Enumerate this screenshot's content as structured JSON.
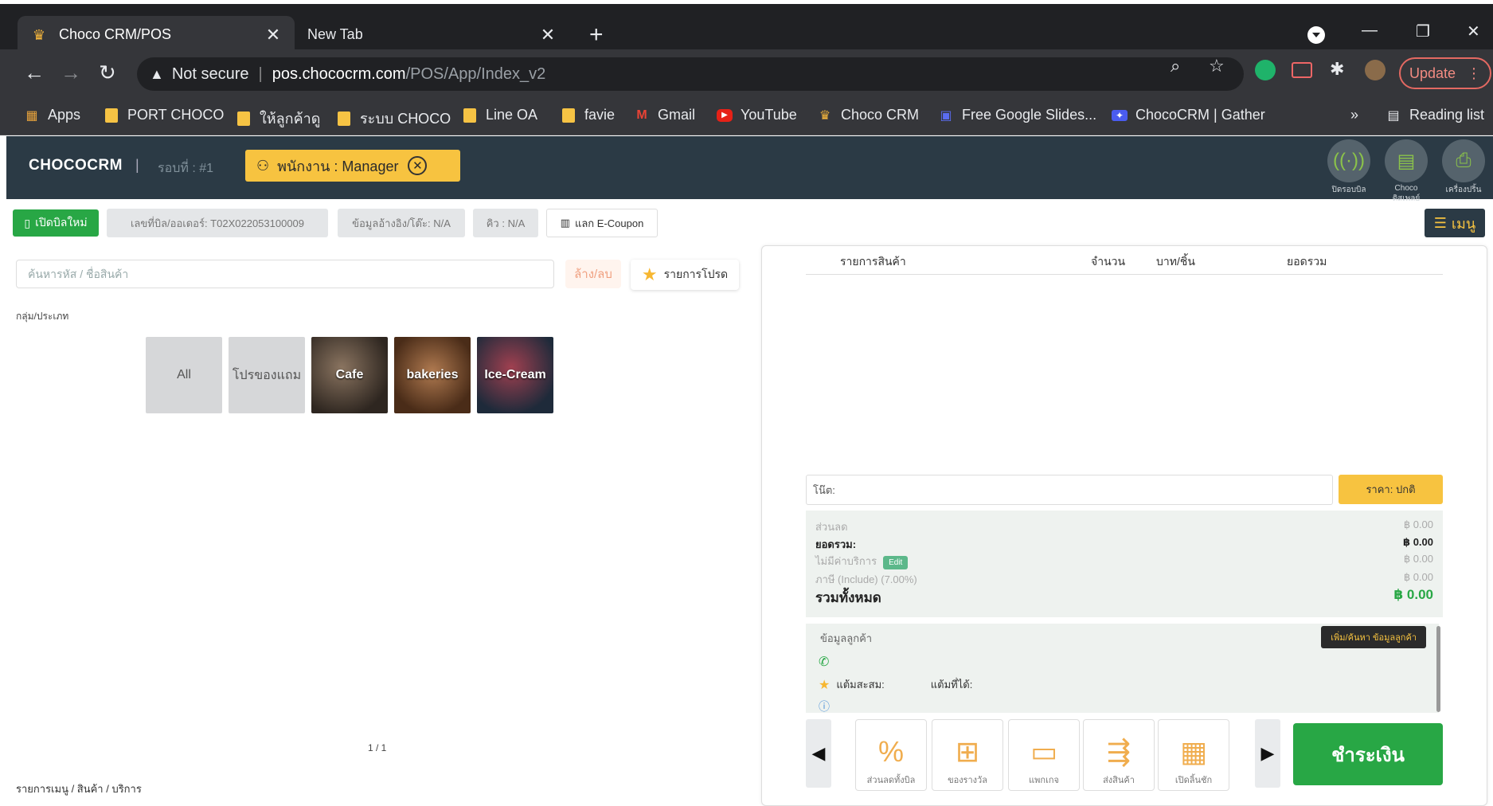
{
  "browser": {
    "tabs": [
      {
        "title": "Choco CRM/POS",
        "icon": "choco-logo-icon",
        "active": true
      },
      {
        "title": "New Tab",
        "icon": "",
        "active": false
      }
    ],
    "address": {
      "security_label": "Not secure",
      "url_host": "pos.chococrm.com",
      "url_path": "/POS/App/Index_v2"
    },
    "update_label": "Update",
    "bookmarks": [
      {
        "label": "Apps",
        "icon": "apps-grid-icon"
      },
      {
        "label": "PORT CHOCO",
        "icon": "folder-icon"
      },
      {
        "label": "ให้ลูกค้าดู",
        "icon": "folder-icon"
      },
      {
        "label": "ระบบ CHOCO",
        "icon": "folder-icon"
      },
      {
        "label": "Line OA",
        "icon": "folder-icon"
      },
      {
        "label": "favie",
        "icon": "folder-icon"
      },
      {
        "label": "Gmail",
        "icon": "gmail-icon"
      },
      {
        "label": "YouTube",
        "icon": "youtube-icon"
      },
      {
        "label": "Choco CRM",
        "icon": "choco-logo-icon"
      },
      {
        "label": "Free Google Slides...",
        "icon": "slides-icon"
      },
      {
        "label": "ChocoCRM | Gather",
        "icon": "gather-icon"
      }
    ],
    "more_bookmarks": "»",
    "reading_list": "Reading list"
  },
  "header": {
    "brand": "CHOCOCRM",
    "separator": "|",
    "round_label": "รอบที่ : #1",
    "staff_label": "พนักงาน : Manager",
    "tools": [
      {
        "label": "ปิดรอบบิล",
        "icon": "broadcast-icon"
      },
      {
        "label": "Choco ดิสเพลย์",
        "icon": "display-icon"
      },
      {
        "label": "เครื่องปริ้น",
        "icon": "printer-icon"
      }
    ]
  },
  "toolbar": {
    "new_bill": "เปิดบิลใหม่",
    "bill_no": "เลขที่บิล/ออเดอร์: T02X022053100009",
    "ref_info": "ข้อมูลอ้างอิง/โต๊ะ: N/A",
    "queue": "คิว : N/A",
    "ecoupon": "แลก E-Coupon",
    "menu": "เมนู"
  },
  "left": {
    "search_placeholder": "ค้นหารหัส / ชื่อสินค้า",
    "clear": "ล้าง/ลบ",
    "favorites": "รายการโปรด",
    "group_label": "กลุ่ม/ประเภท",
    "categories": [
      {
        "label": "All",
        "style": "plain"
      },
      {
        "label": "โปรของแถม",
        "style": "plain"
      },
      {
        "label": "Cafe",
        "style": "photo",
        "color": "#4a3a30"
      },
      {
        "label": "bakeries",
        "style": "photo",
        "color": "#7a4a2a"
      },
      {
        "label": "Ice-Cream",
        "style": "photo",
        "color": "#6a2030"
      }
    ],
    "pager": "1 / 1",
    "footer": "รายการเมนู / สินค้า / บริการ"
  },
  "right": {
    "columns": {
      "item": "รายการสินค้า",
      "qty": "จำนวน",
      "unit_price": "บาท/ชิ้น",
      "total": "ยอดรวม"
    },
    "note_label": "โน๊ต:",
    "price_button": "ราคา: ปกติ",
    "summary": {
      "discount": {
        "label": "ส่วนลด",
        "value": "฿ 0.00"
      },
      "subtotal": {
        "label": "ยอดรวม:",
        "value": "฿ 0.00"
      },
      "service": {
        "label": "ไม่มีค่าบริการ",
        "tag": "Edit",
        "value": "฿ 0.00"
      },
      "tax": {
        "label": "ภาษี (Include) (7.00%)",
        "value": "฿ 0.00"
      },
      "grand": {
        "label": "รวมทั้งหมด",
        "value": "฿ 0.00"
      }
    },
    "customer": {
      "title": "ข้อมูลลูกค้า",
      "button": "เพิ่ม/ค้นหา ข้อมูลลูกค้า",
      "points_label": "แต้มสะสม:",
      "earned_label": "แต้มที่ได้:"
    },
    "actions": [
      {
        "label": "ส่วนลดทั้งบิล",
        "icon": "percent-discount-icon"
      },
      {
        "label": "ของรางวัล",
        "icon": "gift-icon"
      },
      {
        "label": "แพกเกจ",
        "icon": "package-icon"
      },
      {
        "label": "ส่งสินค้า",
        "icon": "delivery-icon"
      },
      {
        "label": "เปิดลิ้นชัก",
        "icon": "cash-drawer-icon"
      }
    ],
    "pay": "ชำระเงิน"
  }
}
